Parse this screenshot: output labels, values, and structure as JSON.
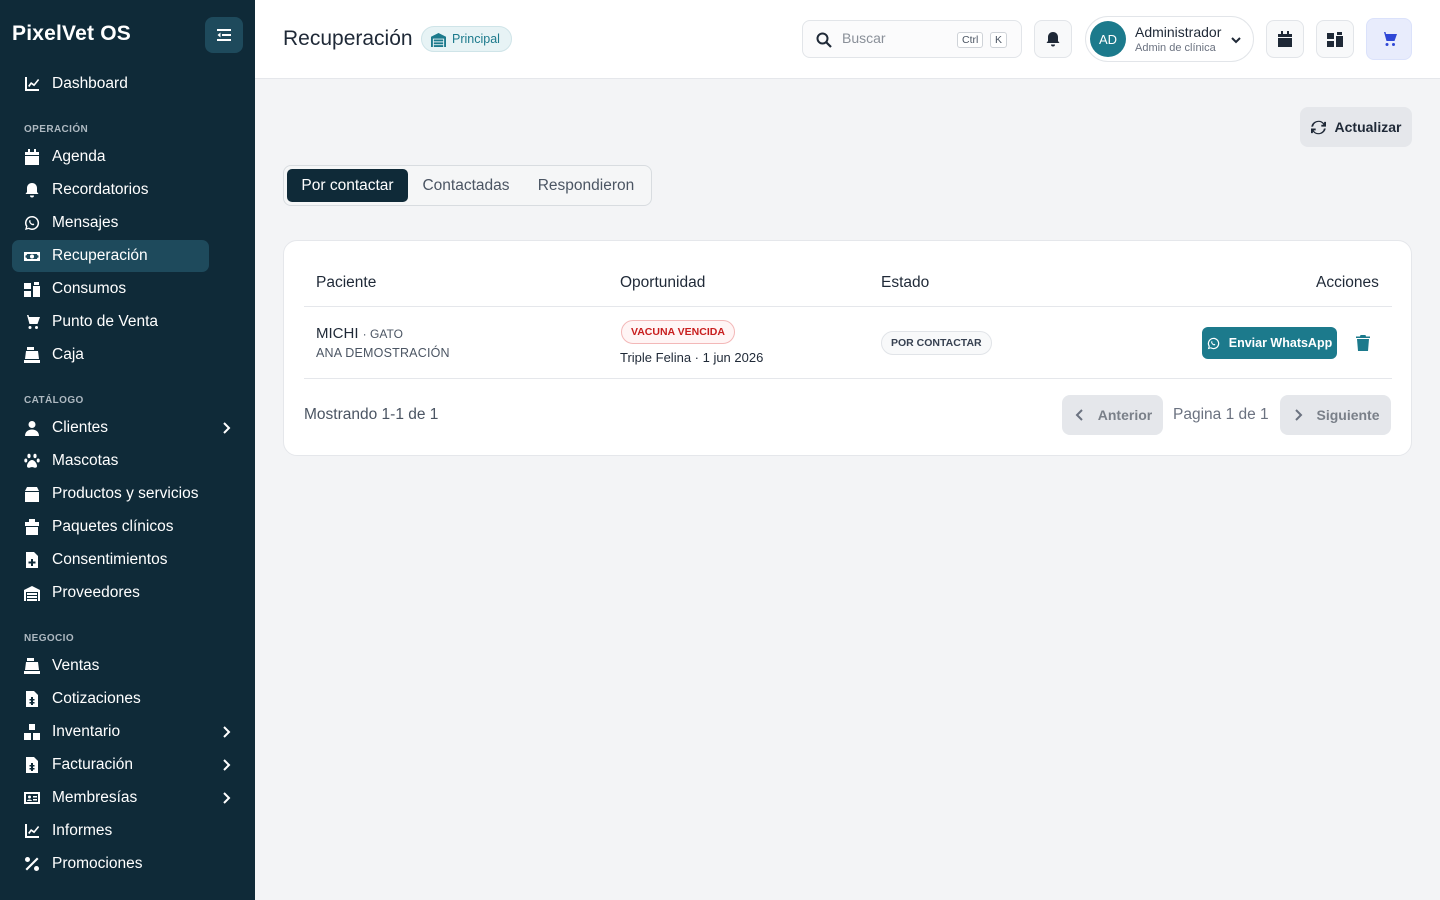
{
  "app": {
    "brand": "PixelVet OS"
  },
  "sidebar": {
    "dashboard": "Dashboard",
    "sections": {
      "operacion": "OPERACIÓN",
      "catalogo": "CATÁLOGO",
      "negocio": "NEGOCIO"
    },
    "items": [
      {
        "label": "Agenda",
        "icon": "calendar-icon"
      },
      {
        "label": "Recordatorios",
        "icon": "bell-icon"
      },
      {
        "label": "Mensajes",
        "icon": "whatsapp-icon"
      },
      {
        "label": "Recuperación",
        "icon": "money-icon",
        "active": true
      },
      {
        "label": "Consumos",
        "icon": "boxes-icon"
      },
      {
        "label": "Punto de Venta",
        "icon": "cart-icon"
      },
      {
        "label": "Caja",
        "icon": "cash-register-icon"
      },
      {
        "label": "Clientes",
        "icon": "user-icon",
        "expandable": true
      },
      {
        "label": "Mascotas",
        "icon": "paw-icon"
      },
      {
        "label": "Productos y servicios",
        "icon": "box-icon"
      },
      {
        "label": "Paquetes clínicos",
        "icon": "package-icon"
      },
      {
        "label": "Consentimientos",
        "icon": "file-medical-icon"
      },
      {
        "label": "Proveedores",
        "icon": "warehouse-icon"
      },
      {
        "label": "Ventas",
        "icon": "cash-register-icon"
      },
      {
        "label": "Cotizaciones",
        "icon": "invoice-dollar-icon"
      },
      {
        "label": "Inventario",
        "icon": "boxes-stacked-icon",
        "expandable": true
      },
      {
        "label": "Facturación",
        "icon": "invoice-icon",
        "expandable": true
      },
      {
        "label": "Membresías",
        "icon": "id-card-icon",
        "expandable": true
      },
      {
        "label": "Informes",
        "icon": "chart-line-icon"
      },
      {
        "label": "Promociones",
        "icon": "percent-icon"
      }
    ]
  },
  "header": {
    "title": "Recuperación",
    "branch": "Principal",
    "search_placeholder": "Buscar",
    "kbd_ctrl": "Ctrl",
    "kbd_k": "K",
    "user": {
      "initials": "AD",
      "name": "Administrador",
      "role": "Admin de clínica"
    }
  },
  "toolbar": {
    "refresh_label": "Actualizar"
  },
  "tabs": [
    "Por contactar",
    "Contactadas",
    "Respondieron"
  ],
  "table": {
    "columns": [
      "Paciente",
      "Oportunidad",
      "Estado",
      "Acciones"
    ],
    "rows": [
      {
        "patient": "MICHI",
        "species": "· GATO",
        "owner": "ANA DEMOSTRACIÓN",
        "opportunity": "VACUNA VENCIDA",
        "detail": "Triple Felina · 1 jun 2026",
        "status": "POR CONTACTAR",
        "action": "Enviar WhatsApp"
      }
    ]
  },
  "pagination": {
    "showing": "Mostrando 1-1 de 1",
    "prev": "Anterior",
    "info": "Pagina 1 de 1",
    "next": "Siguiente"
  },
  "colors": {
    "sidebar": "#0f2a38",
    "accent": "#1c7a8c",
    "danger": "#c81e1e",
    "cart": "#2f47d6"
  }
}
